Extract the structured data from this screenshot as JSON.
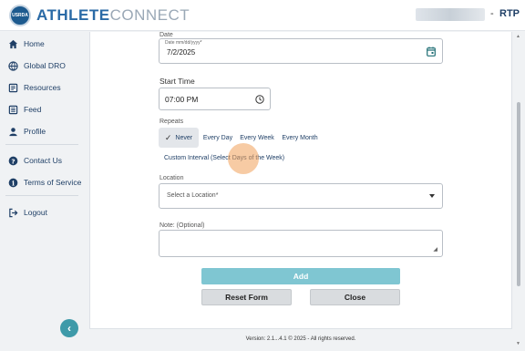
{
  "header": {
    "badge_text": "USRDA",
    "brand_bold": "ATHLETE",
    "brand_light": "CONNECT",
    "user_separator": "-",
    "user_code": "RTP"
  },
  "sidebar": {
    "items": [
      {
        "label": "Home",
        "icon": "home-icon"
      },
      {
        "label": "Global DRO",
        "icon": "globe-icon"
      },
      {
        "label": "Resources",
        "icon": "book-icon"
      },
      {
        "label": "Feed",
        "icon": "feed-icon"
      },
      {
        "label": "Profile",
        "icon": "user-icon"
      },
      {
        "label": "Contact Us",
        "icon": "question-icon"
      },
      {
        "label": "Terms of Service",
        "icon": "info-icon"
      },
      {
        "label": "Logout",
        "icon": "logout-icon"
      }
    ],
    "collapse_glyph": "‹"
  },
  "form": {
    "date_label": "Date",
    "date_hint": "Date mm/dd/yyyy*",
    "date_value": "7/2/2025",
    "start_time_label": "Start Time",
    "start_time_value": "07:00 PM",
    "repeats_label": "Repeats",
    "repeat_options": [
      "Never",
      "Every Day",
      "Every Week",
      "Every Month"
    ],
    "repeat_selected": "Never",
    "custom_interval": "Custom Interval (Select Days of the Week)",
    "location_label": "Location",
    "location_placeholder": "Select a Location*",
    "note_label": "Note: (Optional)",
    "add_button": "Add",
    "reset_button": "Reset Form",
    "close_button": "Close"
  },
  "footer": {
    "text": "Version: 2.1...4.1 © 2025 - All rights reserved."
  },
  "colors": {
    "brand_blue": "#2a6aa6",
    "nav_text": "#1f3f66",
    "accent_teal": "#7fc6d2",
    "collapse_teal": "#3e9aa9"
  }
}
